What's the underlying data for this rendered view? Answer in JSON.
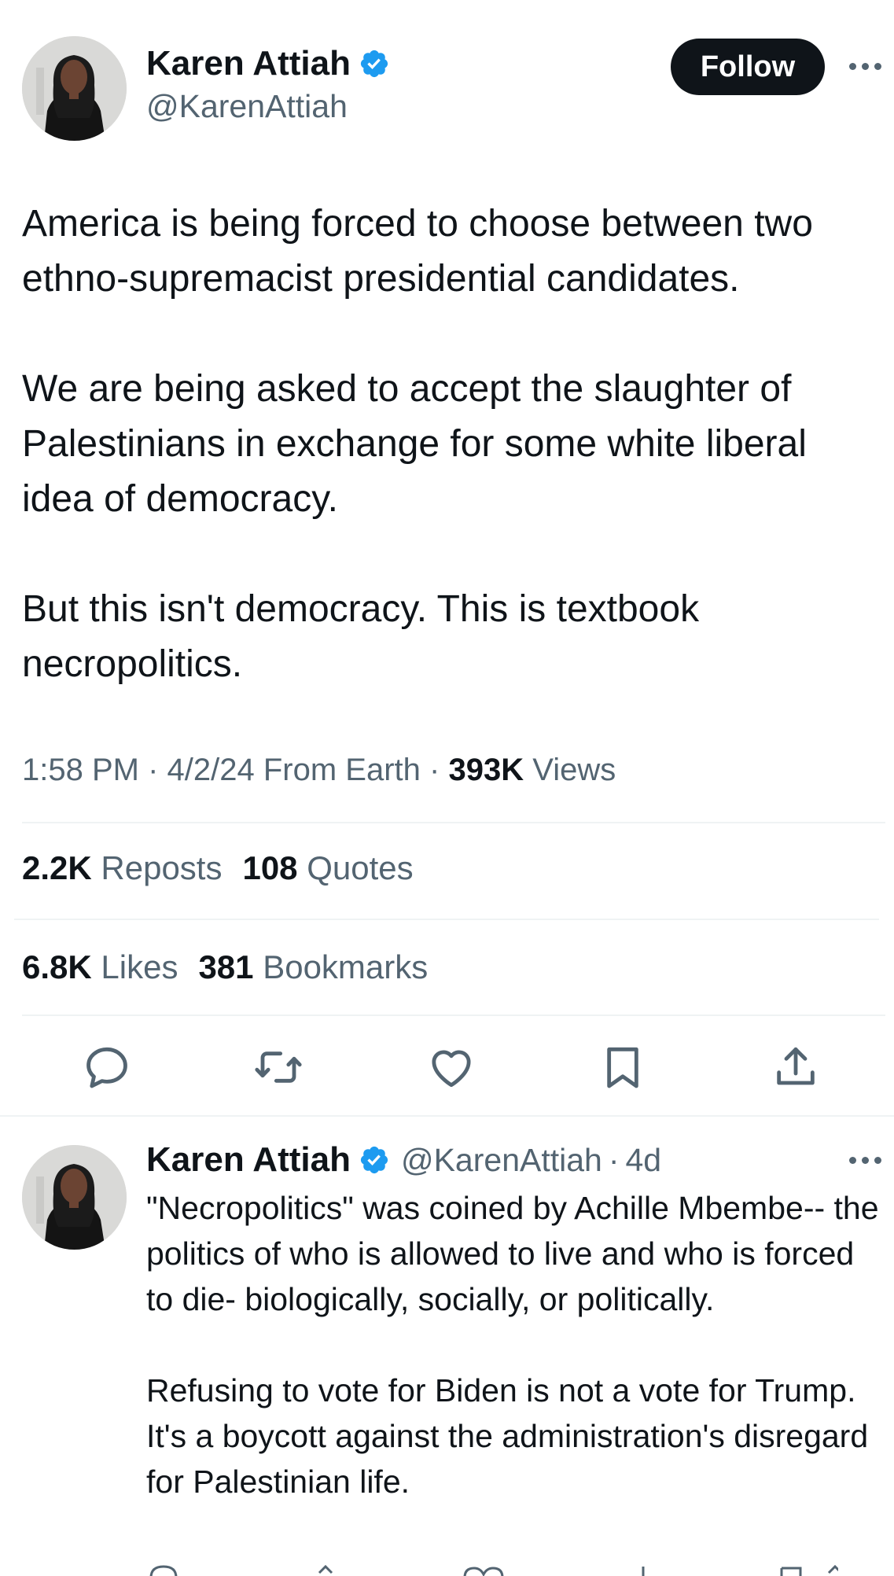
{
  "tweet": {
    "author": {
      "name": "Karen Attiah",
      "handle": "@KarenAttiah",
      "verified": true
    },
    "follow_label": "Follow",
    "paragraphs": [
      "America is being forced to choose between two ethno-supremacist presidential candidates.",
      "We are being asked to accept the slaughter of Palestinians in exchange for some white liberal idea of democracy.",
      "But this isn't democracy. This is textbook necropolitics."
    ],
    "meta": {
      "time": "1:58 PM",
      "date": "4/2/24",
      "location": "From Earth",
      "views_count": "393K",
      "views_label": "Views"
    },
    "stats": {
      "reposts_count": "2.2K",
      "reposts_label": "Reposts",
      "quotes_count": "108",
      "quotes_label": "Quotes",
      "likes_count": "6.8K",
      "likes_label": "Likes",
      "bookmarks_count": "381",
      "bookmarks_label": "Bookmarks"
    },
    "actions": [
      "reply-icon",
      "repost-icon",
      "like-icon",
      "bookmark-icon",
      "share-icon"
    ]
  },
  "reply": {
    "author": {
      "name": "Karen Attiah",
      "handle": "@KarenAttiah",
      "verified": true
    },
    "age": "4d",
    "paragraphs": [
      "\"Necropolitics\" was coined by Achille Mbembe-- the politics of who is allowed to live and who is forced to die- biologically, socially, or politically.",
      "Refusing to vote for Biden is not a vote for Trump. It's a boycott against the administration's disregard for Palestinian life."
    ]
  },
  "colors": {
    "text_primary": "#0f1419",
    "text_secondary": "#536471",
    "verified_blue": "#1d9bf0",
    "divider": "#eff3f4",
    "follow_bg": "#0f1419"
  }
}
